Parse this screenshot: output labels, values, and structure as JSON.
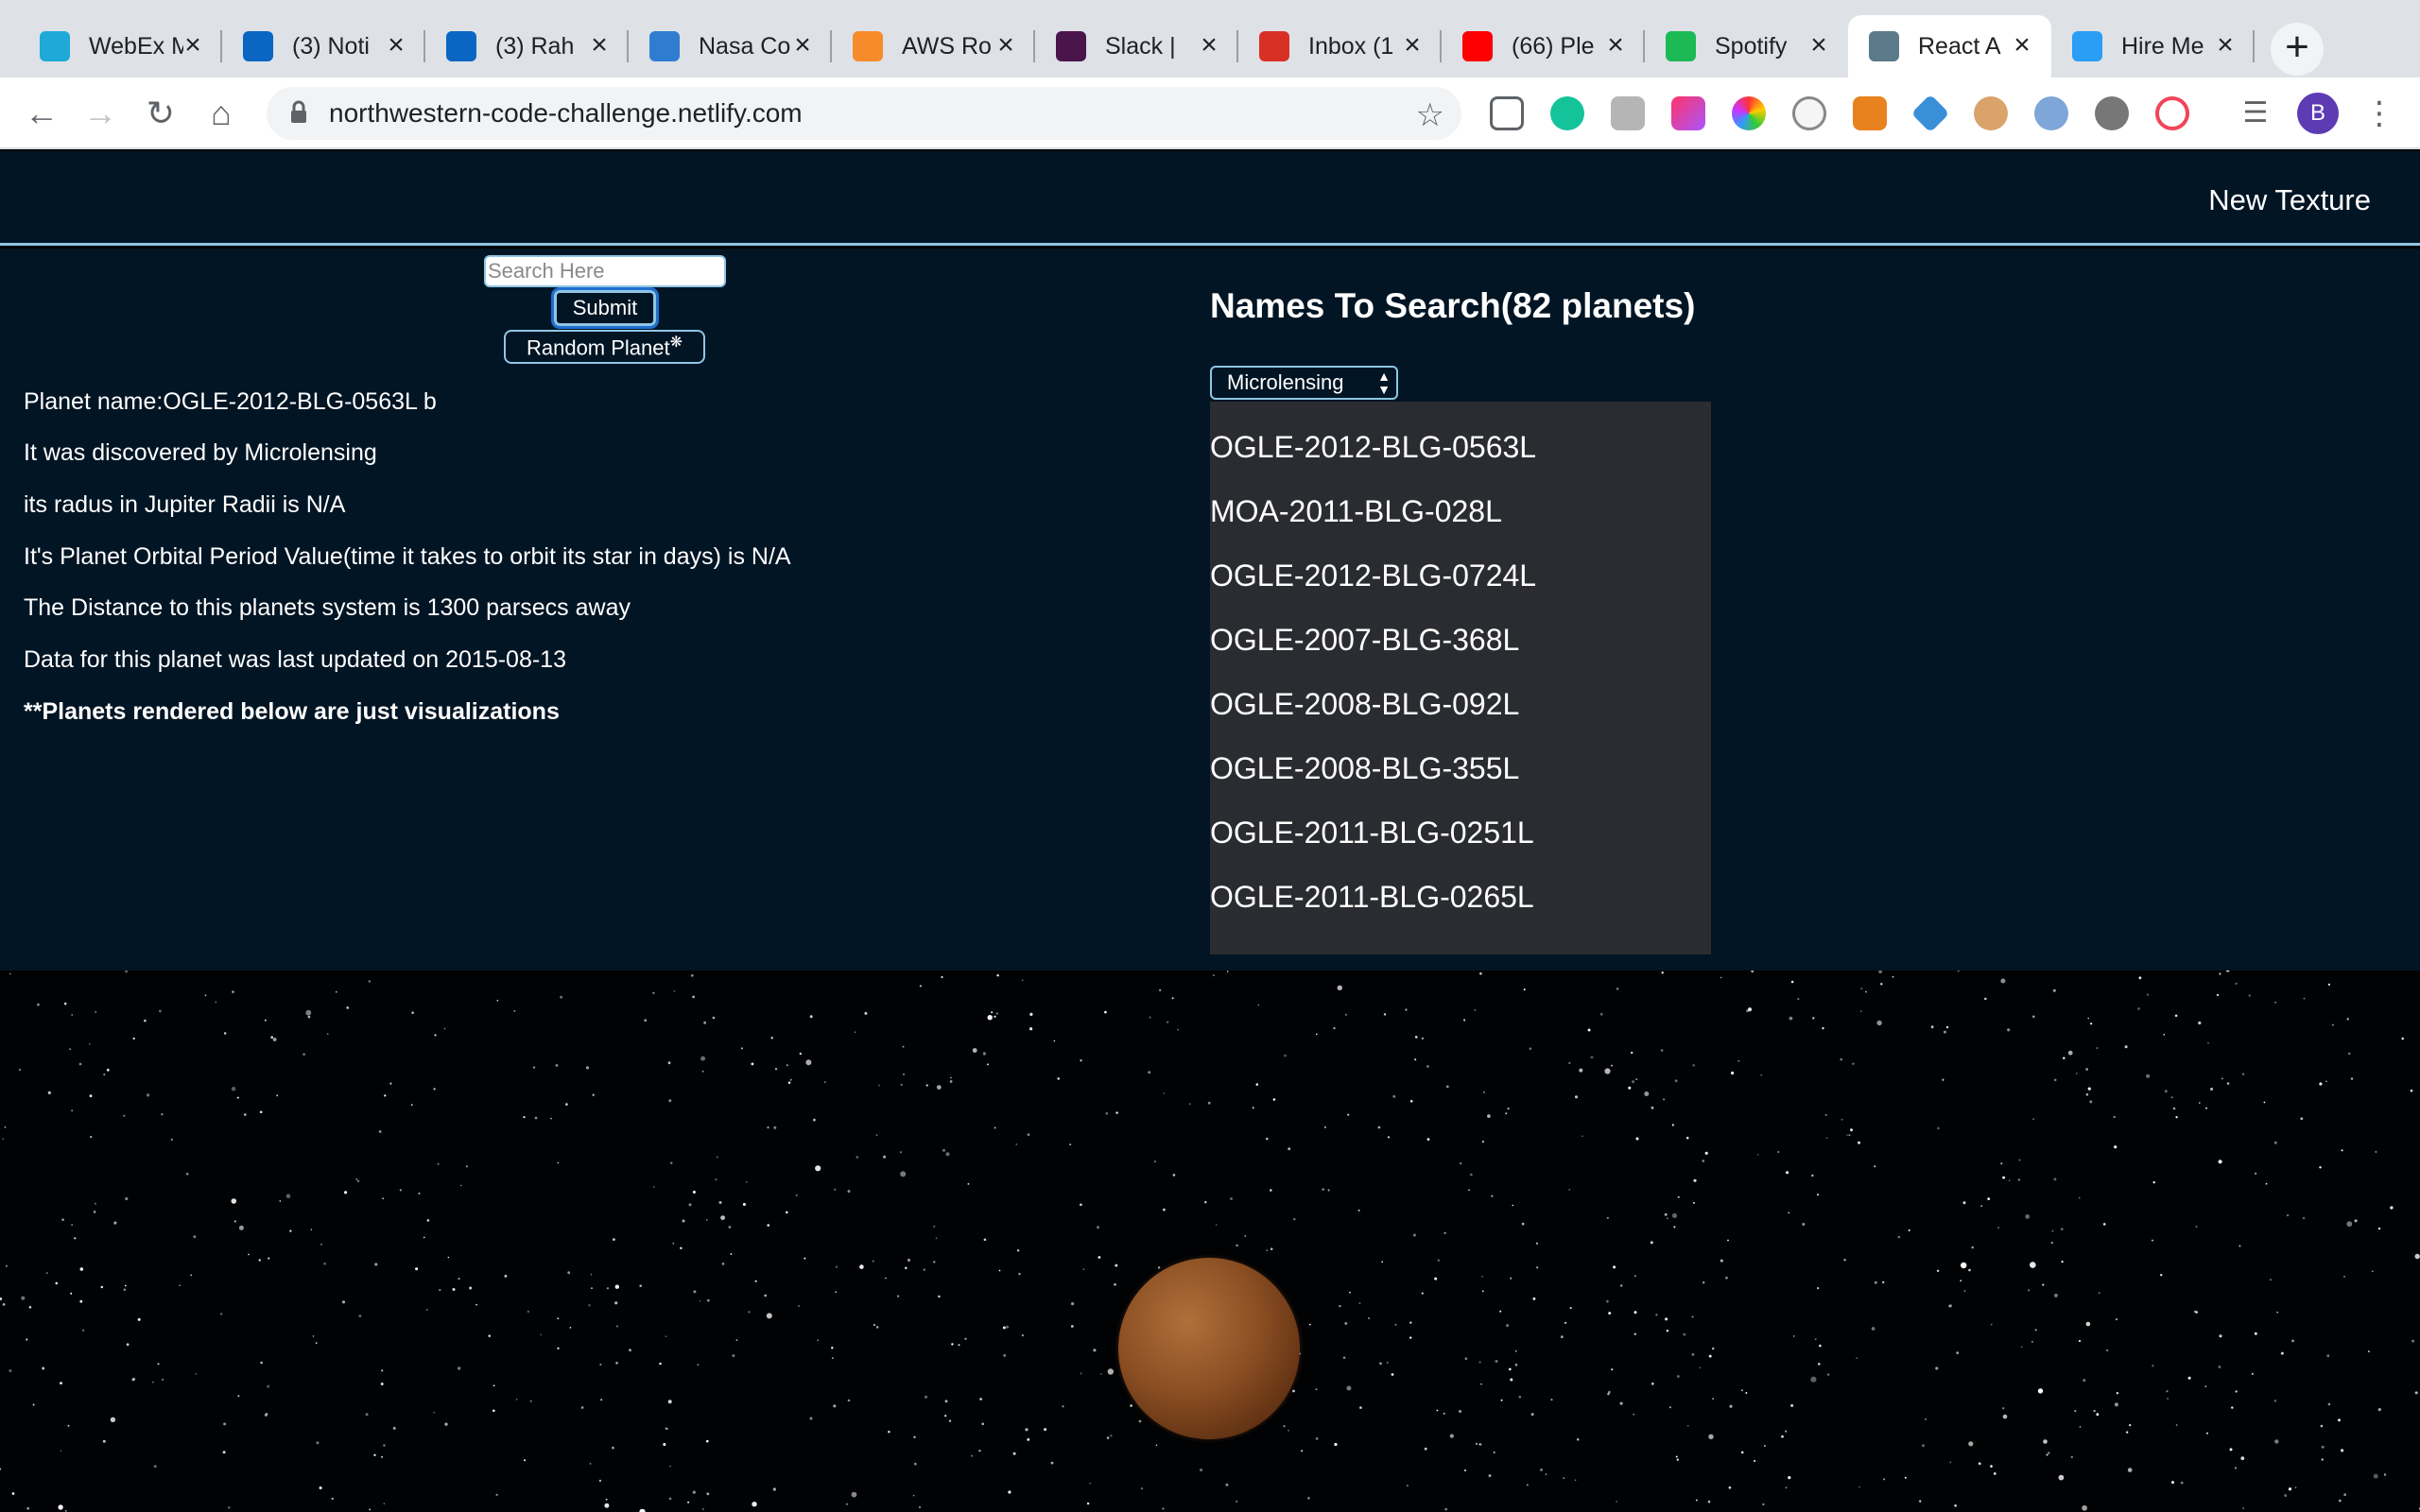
{
  "browser": {
    "tabs": [
      {
        "title": "WebEx M",
        "icon": "webex-icon",
        "color": "#1fa9d9"
      },
      {
        "title": "(3) Noti",
        "icon": "linkedin-icon",
        "color": "#0a66c2"
      },
      {
        "title": "(3) Rah",
        "icon": "linkedin-icon",
        "color": "#0a66c2"
      },
      {
        "title": "Nasa Co",
        "icon": "api-icon",
        "color": "#2f7dd1"
      },
      {
        "title": "AWS Ro",
        "icon": "aws-icon",
        "color": "#f58b2a"
      },
      {
        "title": "Slack | ",
        "icon": "slack-icon",
        "color": "#4a154b"
      },
      {
        "title": "Inbox (1",
        "icon": "gmail-icon",
        "color": "#d93025"
      },
      {
        "title": "(66) Ple",
        "icon": "youtube-icon",
        "color": "#ff0000"
      },
      {
        "title": "Spotify",
        "icon": "spotify-icon",
        "color": "#1db954"
      },
      {
        "title": "React A",
        "icon": "react-icon",
        "color": "#5b7a8a"
      },
      {
        "title": "Hire Me",
        "icon": "hire-me-icon",
        "color": "#2a9df4"
      }
    ],
    "active_tab_index": 9,
    "url": "northwestern-code-challenge.netlify.com",
    "profile_initial": "B"
  },
  "app": {
    "header": {
      "new_texture_label": "New Texture"
    },
    "search": {
      "placeholder": "Search Here",
      "submit_label": "Submit",
      "random_label": "Random Planet"
    },
    "planet_info": {
      "name_line": "Planet name:OGLE-2012-BLG-0563L b",
      "discovery_line": "It was discovered by Microlensing",
      "radius_line": "its radus in Jupiter Radii is N/A",
      "orbit_line": "It's Planet Orbital Period Value(time it takes to orbit its star in days) is N/A",
      "distance_line": "The Distance to this planets system is 1300 parsecs away",
      "updated_line": "Data for this planet was last updated on 2015-08-13",
      "note_line": "**Planets rendered below are just visualizations"
    },
    "names_panel": {
      "heading": "Names To Search(82 planets)",
      "selected_method": "Microlensing",
      "planets": [
        "OGLE-2012-BLG-0563L",
        "MOA-2011-BLG-028L",
        "OGLE-2012-BLG-0724L",
        "OGLE-2007-BLG-368L",
        "OGLE-2008-BLG-092L",
        "OGLE-2008-BLG-355L",
        "OGLE-2011-BLG-0251L",
        "OGLE-2011-BLG-0265L"
      ]
    },
    "colors": {
      "background": "#021524",
      "accent": "#8fc6e4",
      "list_background": "#2a2c31",
      "planet": "#8a4e22"
    }
  }
}
